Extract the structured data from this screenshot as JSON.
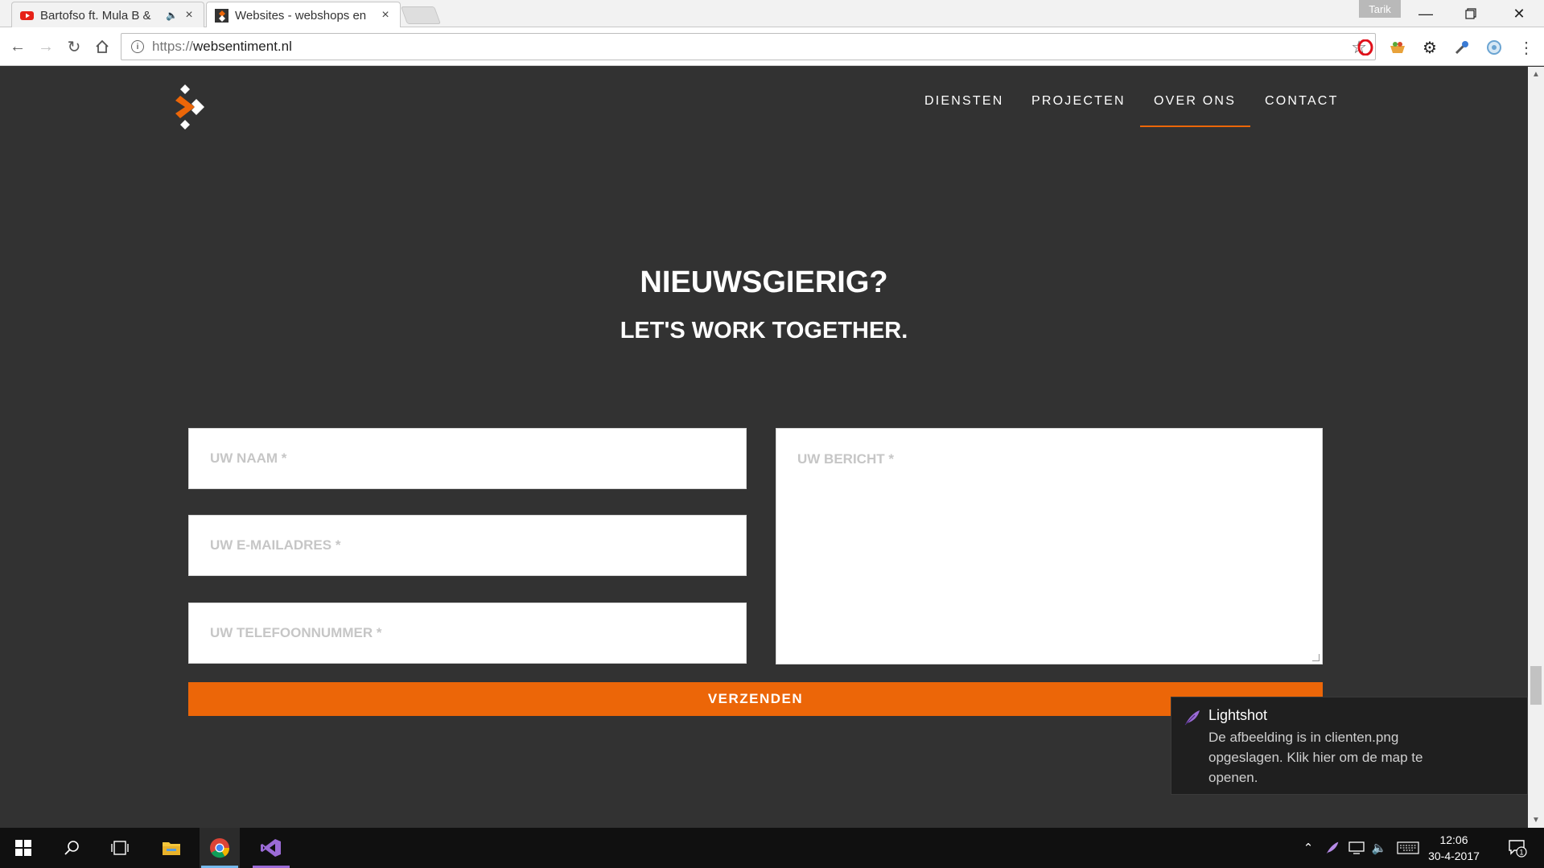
{
  "browser": {
    "tabs": [
      {
        "title": "Bartofso ft. Mula B &",
        "has_audio": true,
        "active": false
      },
      {
        "title": "Websites - webshops en",
        "has_audio": false,
        "active": true
      }
    ],
    "profile_name": "Tarik",
    "url_scheme": "https://",
    "url_host": "websentiment.nl"
  },
  "site": {
    "nav": {
      "diensten": "DIENSTEN",
      "projecten": "PROJECTEN",
      "over_ons": "OVER ONS",
      "contact": "CONTACT",
      "active": "OVER ONS"
    },
    "heading": "NIEUWSGIERIG?",
    "subheading": "LET'S WORK TOGETHER.",
    "form": {
      "name_placeholder": "UW NAAM *",
      "email_placeholder": "UW E-MAILADRES *",
      "phone_placeholder": "UW TELEFOONNUMMER *",
      "message_placeholder": "UW BERICHT *",
      "submit_label": "VERZENDEN"
    },
    "accent_color": "#ec6608",
    "background_color": "#323232"
  },
  "notification": {
    "title": "Lightshot",
    "message": "De afbeelding is in clienten.png opgeslagen. Klik hier om de map te openen."
  },
  "taskbar": {
    "time": "12:06",
    "date": "30-4-2017",
    "notification_count": "1"
  }
}
